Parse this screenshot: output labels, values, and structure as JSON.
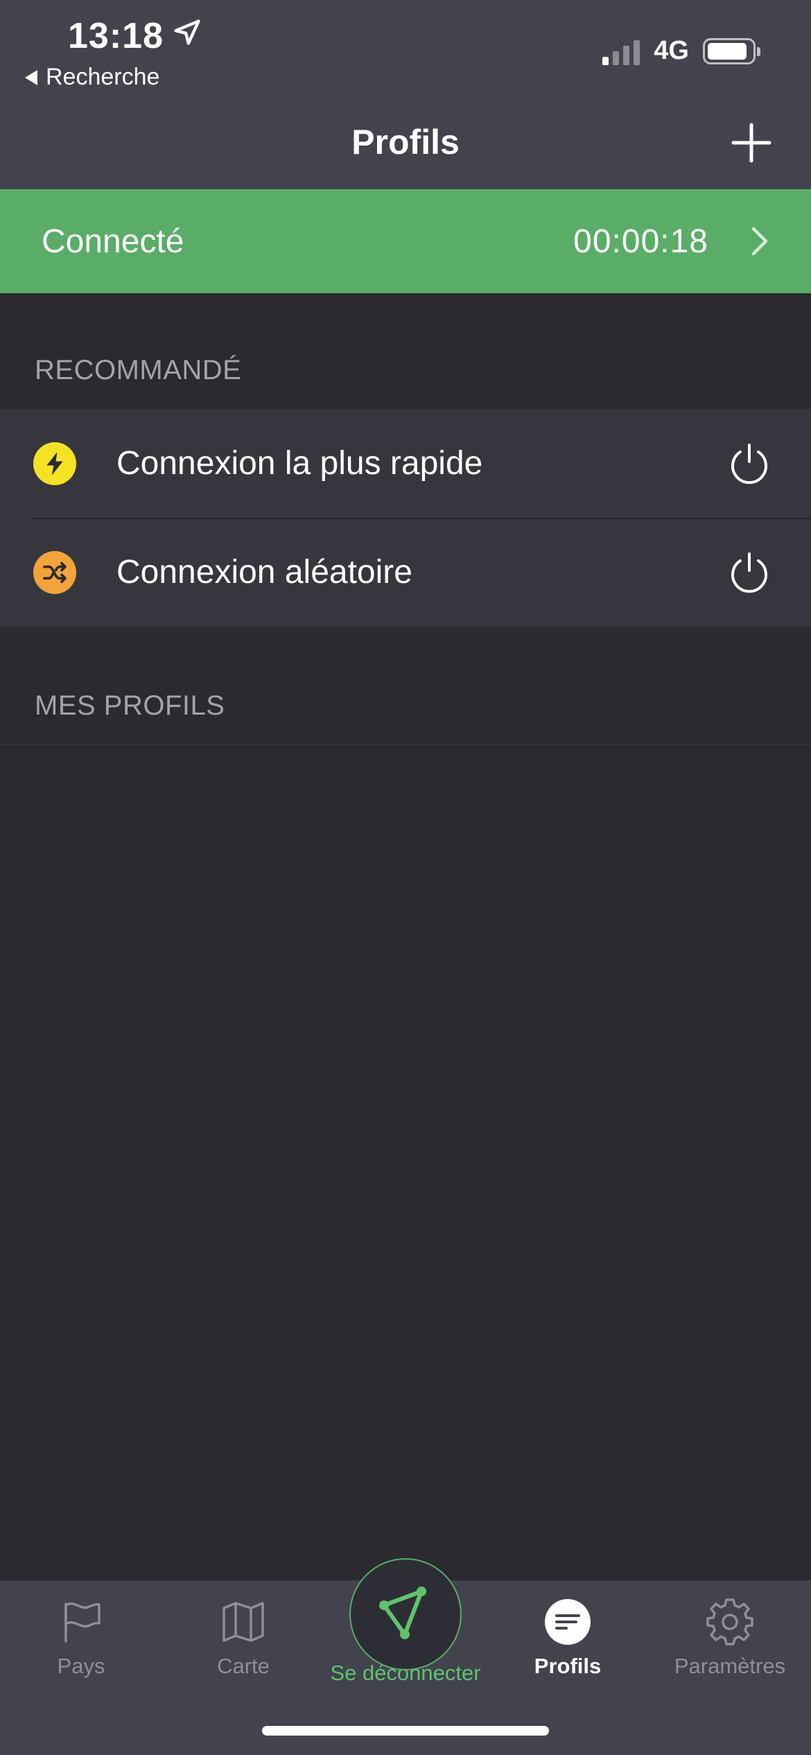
{
  "status": {
    "time": "13:18",
    "back_label": "Recherche",
    "network": "4G"
  },
  "nav": {
    "title": "Profils"
  },
  "banner": {
    "status": "Connecté",
    "timer": "00:00:18",
    "color": "#5aad66"
  },
  "recommended": {
    "header": "RECOMMANDÉ",
    "items": [
      {
        "label": "Connexion la plus rapide",
        "icon": "lightning-icon",
        "icon_color": "#f5e223"
      },
      {
        "label": "Connexion aléatoire",
        "icon": "shuffle-icon",
        "icon_color": "#f2a33a"
      }
    ]
  },
  "my_profiles": {
    "header": "MES PROFILS"
  },
  "tabbar": {
    "tabs": [
      {
        "label": "Pays",
        "icon": "flag-icon"
      },
      {
        "label": "Carte",
        "icon": "map-icon"
      },
      {
        "label": "Se déconnecter",
        "icon": "vpn-triangle-icon"
      },
      {
        "label": "Profils",
        "icon": "profiles-icon"
      },
      {
        "label": "Paramètres",
        "icon": "gear-icon"
      }
    ],
    "active": "Profils",
    "accent": "#5ec46c"
  }
}
